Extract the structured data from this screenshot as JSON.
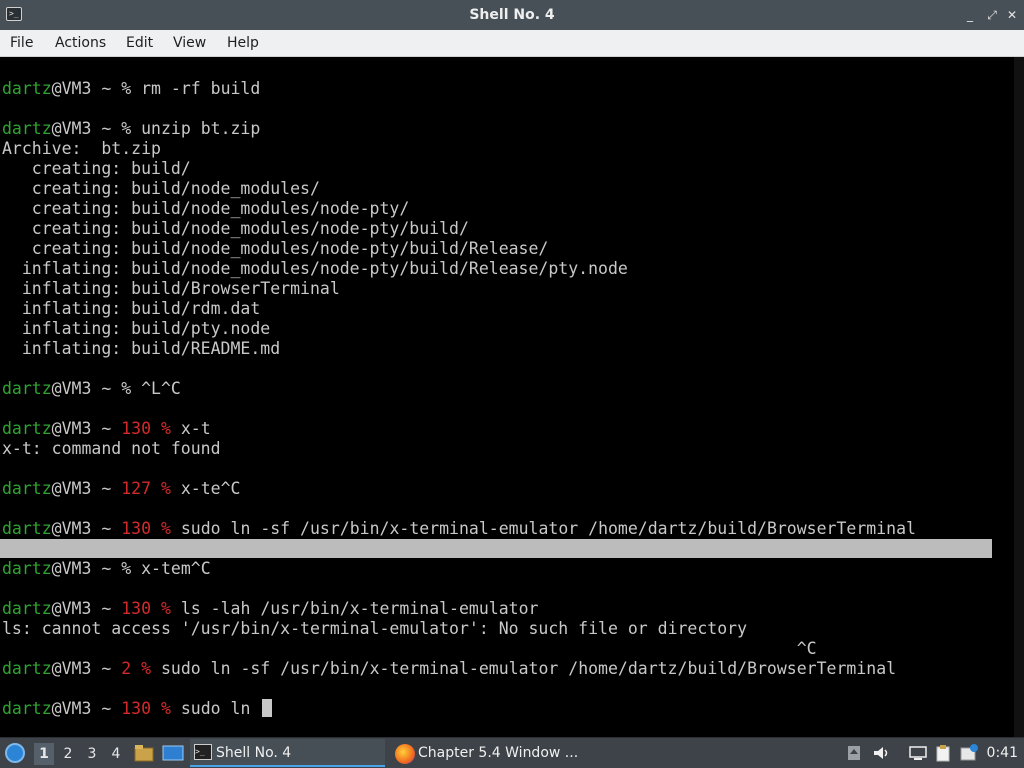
{
  "window": {
    "title": "Shell No. 4",
    "controls": {
      "minimize": "_",
      "maximize": "⤢",
      "close": "✕"
    }
  },
  "menu": [
    "File",
    "Actions",
    "Edit",
    "View",
    "Help"
  ],
  "terminal": {
    "lines": [
      {
        "prompt": "dartz",
        "host": "@VM3 ~ ",
        "code": "",
        "sym": "% ",
        "cmd": "rm -rf build"
      },
      {
        "text": ""
      },
      {
        "prompt": "dartz",
        "host": "@VM3 ~ ",
        "code": "",
        "sym": "% ",
        "cmd": "unzip bt.zip"
      },
      {
        "text": "Archive:  bt.zip"
      },
      {
        "text": "   creating: build/"
      },
      {
        "text": "   creating: build/node_modules/"
      },
      {
        "text": "   creating: build/node_modules/node-pty/"
      },
      {
        "text": "   creating: build/node_modules/node-pty/build/"
      },
      {
        "text": "   creating: build/node_modules/node-pty/build/Release/"
      },
      {
        "text": "  inflating: build/node_modules/node-pty/build/Release/pty.node"
      },
      {
        "text": "  inflating: build/BrowserTerminal"
      },
      {
        "text": "  inflating: build/rdm.dat"
      },
      {
        "text": "  inflating: build/pty.node"
      },
      {
        "text": "  inflating: build/README.md"
      }
    ],
    "lines2": [
      {
        "prompt": "dartz",
        "host": "@VM3 ~ ",
        "code": "",
        "sym": "% ",
        "cmd": "^L^C"
      },
      {
        "prompt": "dartz",
        "host": "@VM3 ~ ",
        "code": "130 ",
        "sym": "% ",
        "cmd": "x-t"
      },
      {
        "text": "x-t: command not found"
      },
      {
        "prompt": "dartz",
        "host": "@VM3 ~ ",
        "code": "127 ",
        "sym": "% ",
        "cmd": "x-te^C"
      },
      {
        "prompt": "dartz",
        "host": "@VM3 ~ ",
        "code": "130 ",
        "sym": "% ",
        "cmd": "sudo ln -sf /usr/bin/x-terminal-emulator /home/dartz/build/BrowserTerminal"
      },
      {
        "prompt": "dartz",
        "host": "@VM3 ~ ",
        "code": "",
        "sym": "% ",
        "cmd": "x-tem^C"
      },
      {
        "prompt": "dartz",
        "host": "@VM3 ~ ",
        "code": "130 ",
        "sym": "% ",
        "cmd": "ls -lah /usr/bin/x-terminal-emulator"
      },
      {
        "text": "ls: cannot access '/usr/bin/x-terminal-emulator': No such file or directory"
      },
      {
        "text": "                                                                                ^C"
      },
      {
        "prompt": "dartz",
        "host": "@VM3 ~ ",
        "code": "2 ",
        "sym": "% ",
        "cmd": "sudo ln -sf /usr/bin/x-terminal-emulator /home/dartz/build/BrowserTerminal"
      },
      {
        "prompt": "dartz",
        "host": "@VM3 ~ ",
        "code": "130 ",
        "sym": "% ",
        "cmd": "sudo ln "
      }
    ]
  },
  "taskbar": {
    "workspaces": [
      "1",
      "2",
      "3",
      "4"
    ],
    "tasks": [
      "Shell No. 4",
      "Chapter 5.4 Window ..."
    ],
    "clock": "0:41"
  },
  "colors": {
    "titlebar": "#475057",
    "menubar": "#eff0f1",
    "prompt_user": "#2fa52f",
    "exit_code": "#d42a2a",
    "taskbar": "#3d4348"
  }
}
